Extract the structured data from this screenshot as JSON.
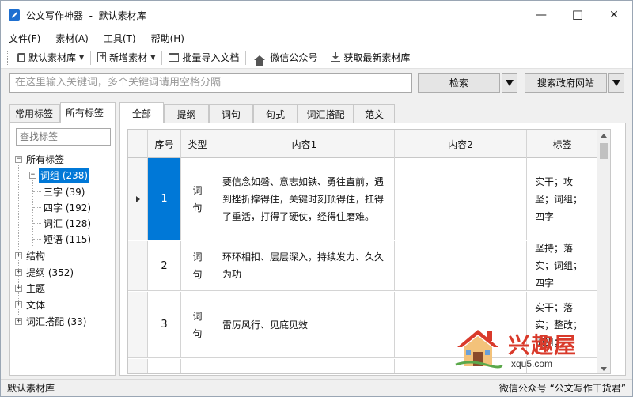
{
  "window": {
    "title": "公文写作神器  -  默认素材库",
    "minimize": "—",
    "maximize": "☐",
    "close": "✕"
  },
  "menu": [
    "文件(F)",
    "素材(A)",
    "工具(T)",
    "帮助(H)"
  ],
  "toolbar": {
    "library_label": "默认素材库",
    "new_label": "新增素材",
    "import_label": "批量导入文档",
    "wechat_label": "微信公众号",
    "fetch_label": "获取最新素材库"
  },
  "search": {
    "placeholder": "在这里输入关键词，多个关键词请用空格分隔",
    "value": "",
    "search_button": "检索",
    "gov_button": "搜索政府网站"
  },
  "left_tabs": [
    "常用标签",
    "所有标签"
  ],
  "tag_filter_placeholder": "查找标签",
  "tree": {
    "root": "所有标签",
    "nodes": [
      {
        "label": "词组 (238)",
        "expander": "−",
        "selected": true
      },
      {
        "label": "三字 (39)"
      },
      {
        "label": "四字 (192)"
      },
      {
        "label": "词汇 (128)"
      },
      {
        "label": "短语 (115)"
      },
      {
        "label": "结构",
        "expander": "+"
      },
      {
        "label": "提纲 (352)",
        "expander": "+"
      },
      {
        "label": "主题",
        "expander": "+"
      },
      {
        "label": "文体",
        "expander": "+"
      },
      {
        "label": "词汇搭配 (33)",
        "expander": "+"
      }
    ],
    "root_expander": "−"
  },
  "right_tabs": [
    "全部",
    "提纲",
    "词句",
    "句式",
    "词汇搭配",
    "范文"
  ],
  "grid": {
    "headers": [
      "序号",
      "类型",
      "内容1",
      "内容2",
      "标签"
    ],
    "rows": [
      {
        "seq": "1",
        "type": "词句",
        "content1": "要信念如磐、意志如铁、勇往直前，遇到挫折撑得住，关键时刻顶得住，扛得了重活，打得了硬仗，经得住磨难。",
        "content2": "",
        "tags": "实干；攻坚；词组；四字"
      },
      {
        "seq": "2",
        "type": "词句",
        "content1": "环环相扣、层层深入，持续发力、久久为功",
        "content2": "",
        "tags": "坚持；落实；词组；四字"
      },
      {
        "seq": "3",
        "type": "词句",
        "content1": "雷厉风行、见底见效",
        "content2": "",
        "tags": "实干；落实；整改；词组；"
      }
    ]
  },
  "watermark": {
    "brand": "兴趣屋",
    "url": "xqu5.com"
  },
  "status": {
    "left": "默认素材库",
    "right": "微信公众号 “公文写作干货君”"
  },
  "colors": {
    "selection": "#0078d7",
    "watermark_red": "#d93a2b"
  }
}
